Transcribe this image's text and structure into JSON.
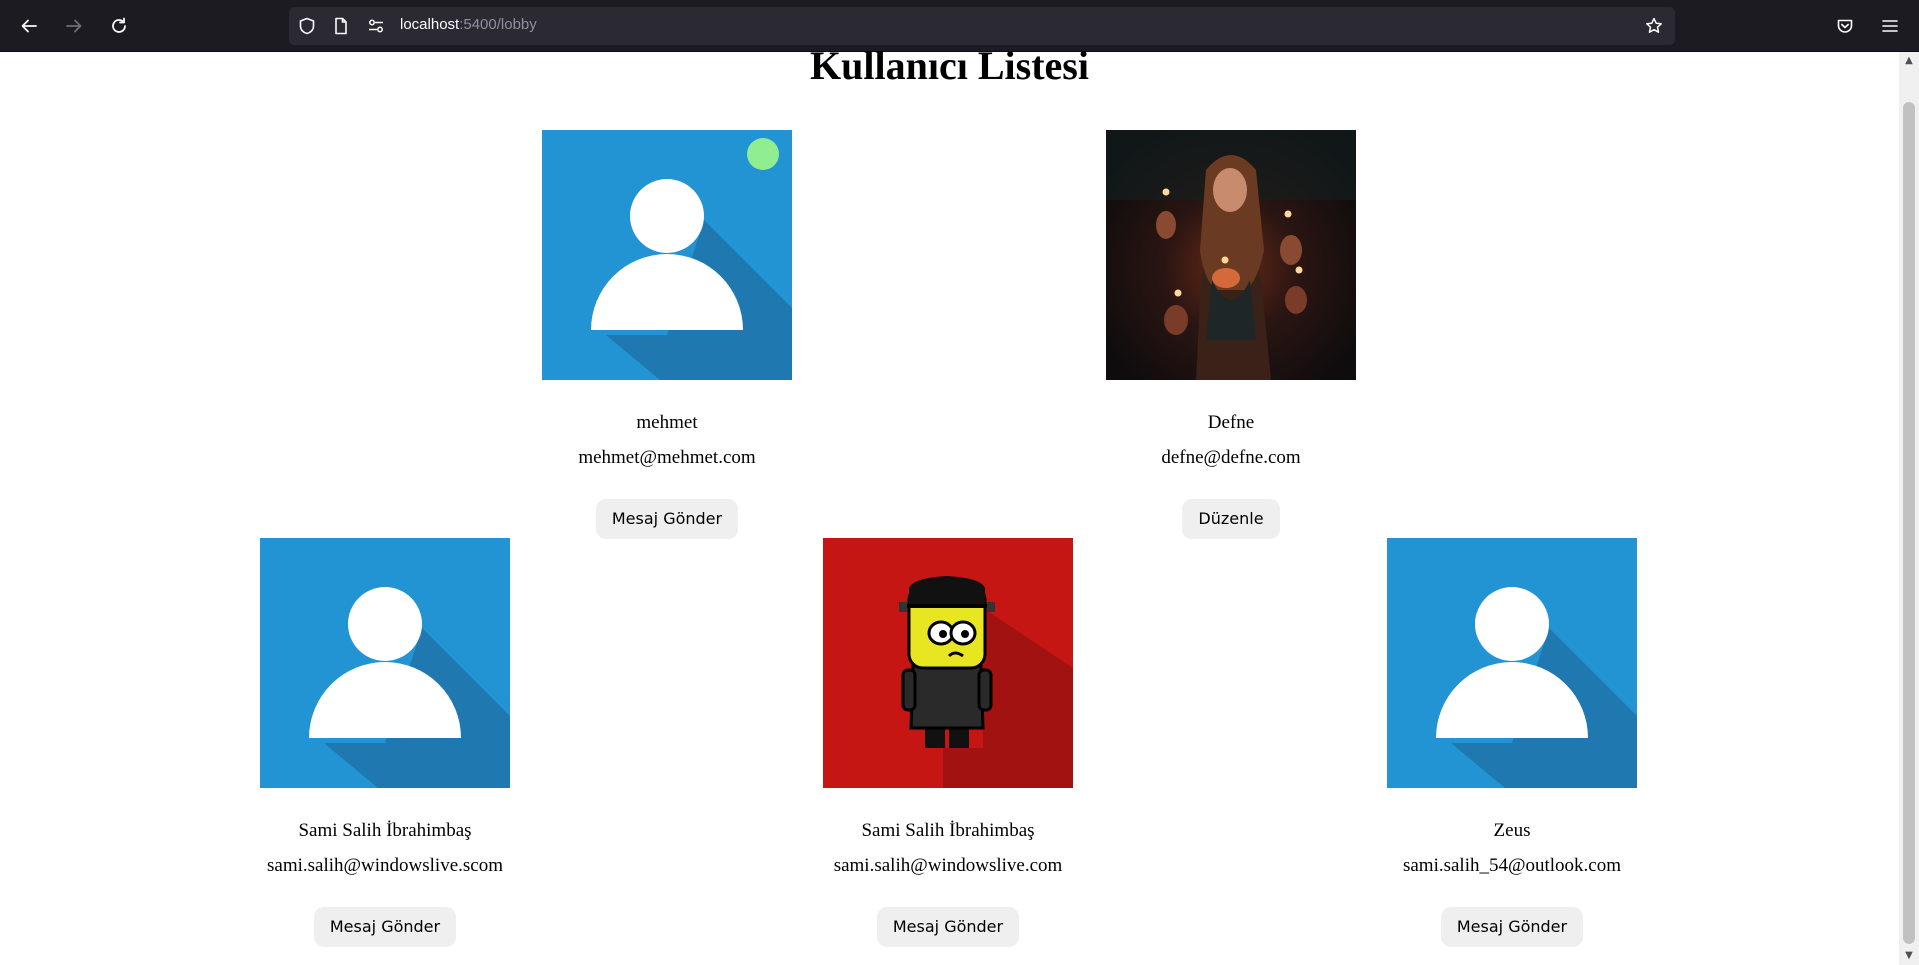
{
  "browser": {
    "url_host": "localhost",
    "url_path": ":5400/lobby",
    "icons": [
      "back-arrow-icon",
      "forward-arrow-icon",
      "reload-icon",
      "shield-icon",
      "page-icon",
      "permissions-icon",
      "bookmark-star-icon",
      "pocket-icon",
      "menu-hamburger-icon"
    ]
  },
  "page": {
    "title": "Kullanıcı Listesi"
  },
  "users": [
    {
      "name": "mehmet",
      "email": "mehmet@mehmet.com",
      "button": "Mesaj Gönder",
      "avatar": "default-user-avatar",
      "online": true,
      "avatar_color": "#2293d3"
    },
    {
      "name": "Defne",
      "email": "defne@defne.com",
      "button": "Düzenle",
      "avatar": "candlelit-portrait-photo",
      "online": false
    },
    {
      "name": "Sami Salih İbrahimbaş",
      "email": "sami.salih@windowslive.scom",
      "button": "Mesaj Gönder",
      "avatar": "default-user-avatar",
      "online": false,
      "avatar_color": "#2293d3"
    },
    {
      "name": "Sami Salih İbrahimbaş",
      "email": "sami.salih@windowslive.com",
      "button": "Mesaj Gönder",
      "avatar": "cartoon-monster-avatar",
      "online": false,
      "avatar_color": "#c51614"
    },
    {
      "name": "Zeus",
      "email": "sami.salih_54@outlook.com",
      "button": "Mesaj Gönder",
      "avatar": "default-user-avatar",
      "online": false,
      "avatar_color": "#2293d3"
    }
  ],
  "colors": {
    "online_indicator": "#90ee90",
    "browser_toolbar": "#1c1b22",
    "url_bar": "#2b2a33"
  }
}
